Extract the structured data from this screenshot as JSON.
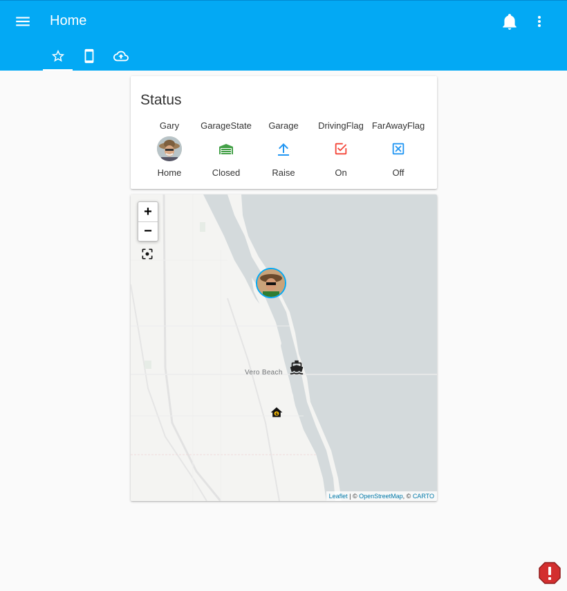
{
  "header": {
    "title": "Home",
    "tabs": [
      {
        "icon": "star-outline-icon",
        "active": true
      },
      {
        "icon": "cellphone-icon",
        "active": false
      },
      {
        "icon": "cloud-upload-icon",
        "active": false
      }
    ]
  },
  "status_card": {
    "title": "Status",
    "entities": [
      {
        "name": "Gary",
        "state": "Home",
        "icon": "avatar-photo",
        "color": "#757575"
      },
      {
        "name": "GarageState",
        "state": "Closed",
        "icon": "garage-icon",
        "color": "#43a047"
      },
      {
        "name": "Garage",
        "state": "Raise",
        "icon": "arrow-collapse-up-icon",
        "color": "#2196f3"
      },
      {
        "name": "DrivingFlag",
        "state": "On",
        "icon": "checkbox-marked-icon",
        "color": "#f44336"
      },
      {
        "name": "FarAwayFlag",
        "state": "Off",
        "icon": "close-box-outline-icon",
        "color": "#2196f3"
      }
    ]
  },
  "map": {
    "zoom_in_label": "+",
    "zoom_out_label": "−",
    "city_label": "Vero Beach",
    "attribution": {
      "leaflet": "Leaflet",
      "separator1": " | © ",
      "osm": "OpenStreetMap",
      "separator2": ", © ",
      "carto": "CARTO"
    }
  },
  "colors": {
    "primary": "#03a9f4",
    "accent": "#ff9800",
    "error": "#d32f2f"
  }
}
